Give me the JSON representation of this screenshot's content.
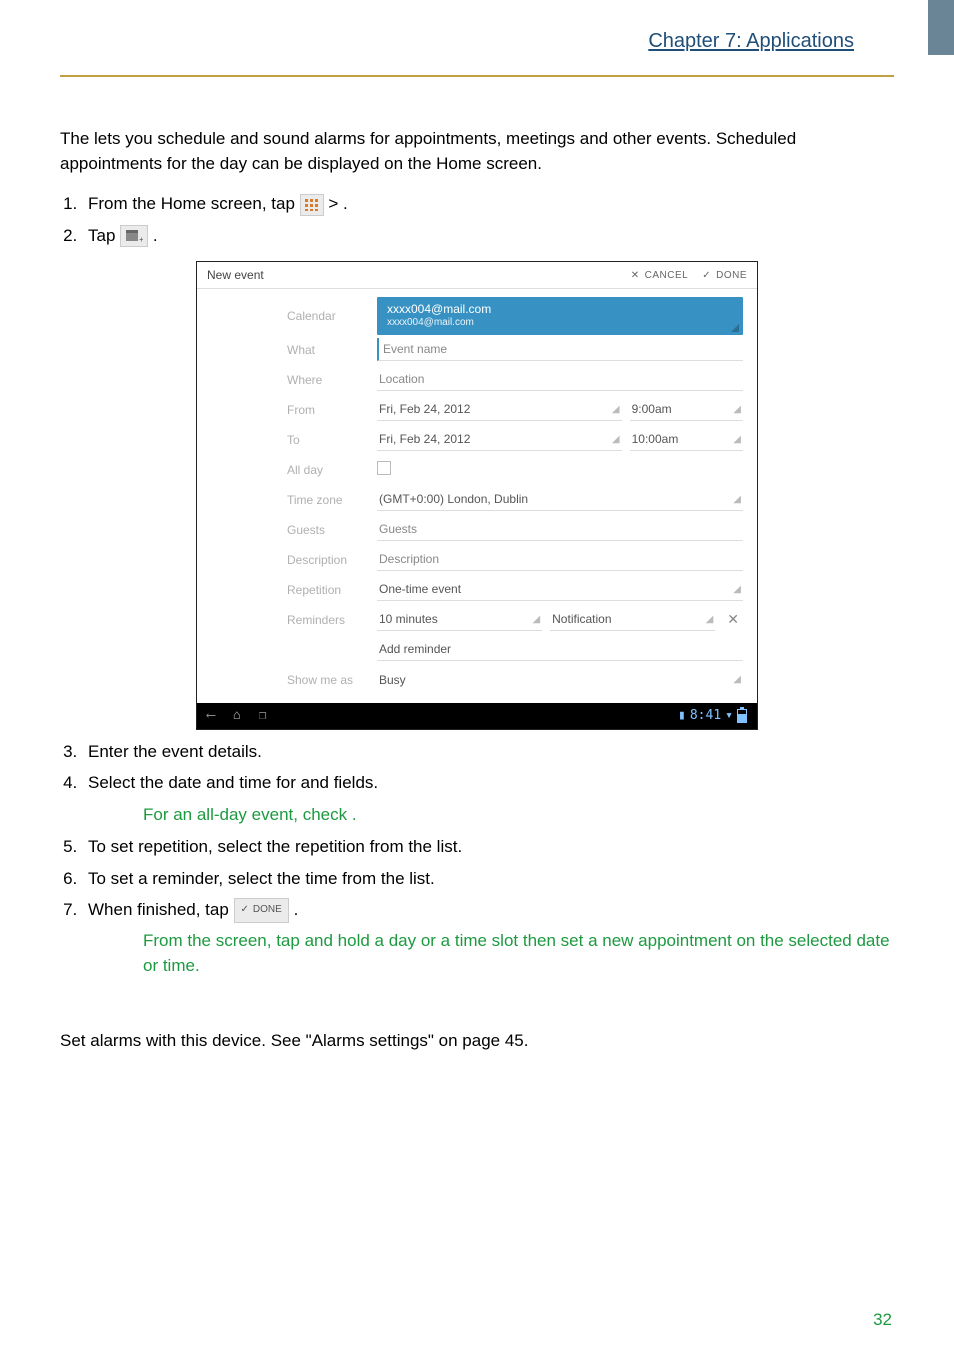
{
  "header": {
    "chapter": "Chapter 7: Applications"
  },
  "intro": "The                lets you schedule and sound alarms for appointments, meetings and other events. Scheduled appointments for the day can be displayed on the Home screen.",
  "steps1": {
    "s1_a": "From the Home screen, tap ",
    "s1_b": " > ",
    "s1_c": ".",
    "s2_a": "Tap ",
    "s2_b": " ."
  },
  "steps2": {
    "s3": "Enter the event details.",
    "s4": "Select the date and time for           and        fields.",
    "note4": "For an all-day event, check             .",
    "s5": "To set repetition, select the repetition from the list.",
    "s6": "To set a reminder, select the time from the list.",
    "s7_a": "When finished, tap ",
    "s7_b": " .",
    "note7": "From the                   screen, tap and hold a day or a time slot then set a new appointment on the selected date or time."
  },
  "alarms_line": "Set alarms with this device. See \"Alarms settings\" on page 45.",
  "page_number": "32",
  "screenshot": {
    "title": "New event",
    "cancel": "CANCEL",
    "done_top": "DONE",
    "done_chip": "DONE",
    "labels": {
      "calendar": "Calendar",
      "what": "What",
      "where": "Where",
      "from": "From",
      "to": "To",
      "all_day": "All day",
      "time_zone": "Time zone",
      "guests": "Guests",
      "description": "Description",
      "repetition": "Repetition",
      "reminders": "Reminders",
      "show_me_as": "Show me as"
    },
    "values": {
      "cal_line1": "xxxx004@mail.com",
      "cal_line2": "xxxx004@mail.com",
      "event_name": "Event name",
      "location": "Location",
      "from_date": "Fri, Feb 24, 2012",
      "from_time": "9:00am",
      "to_date": "Fri, Feb 24, 2012",
      "to_time": "10:00am",
      "tz": "(GMT+0:00) London, Dublin",
      "guests": "Guests",
      "description": "Description",
      "repetition": "One-time event",
      "rem_time": "10 minutes",
      "rem_type": "Notification",
      "add_reminder": "Add reminder",
      "busy": "Busy",
      "clock": "8:41"
    }
  }
}
